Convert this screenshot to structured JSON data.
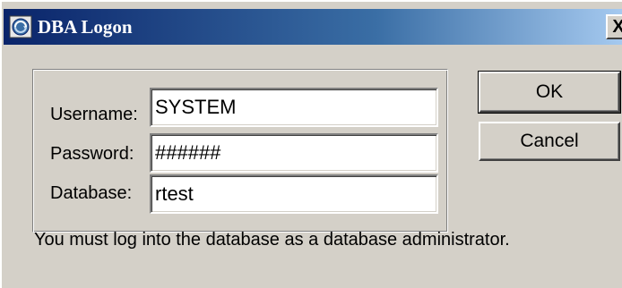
{
  "window": {
    "title": "DBA Logon",
    "close_label": "X",
    "icon": "database-logon-icon"
  },
  "form": {
    "username_label": "Username:",
    "username_value": "SYSTEM",
    "password_label": "Password:",
    "password_value": "######",
    "database_label": "Database:",
    "database_value": "rtest"
  },
  "buttons": {
    "ok_label": "OK",
    "cancel_label": "Cancel"
  },
  "message": "You must log into the database as a database administrator.",
  "colors": {
    "dialog_bg": "#d4d0c8",
    "titlebar_start": "#0a246a",
    "titlebar_end": "#a6caf0",
    "title_text": "#ffffff"
  }
}
